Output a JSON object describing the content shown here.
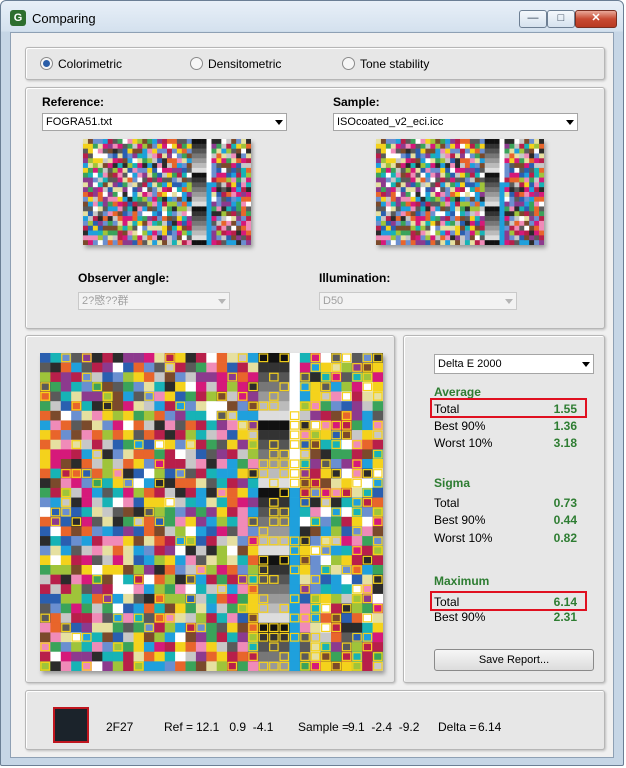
{
  "window": {
    "title": "Comparing",
    "app_icon_glyph": "G"
  },
  "mode": {
    "options": [
      {
        "label": "Colorimetric",
        "selected": true
      },
      {
        "label": "Densitometric",
        "selected": false
      },
      {
        "label": "Tone stability",
        "selected": false
      }
    ]
  },
  "reference": {
    "label": "Reference:",
    "file": "FOGRA51.txt"
  },
  "sample": {
    "label": "Sample:",
    "file": "ISOcoated_v2_eci.icc"
  },
  "observer": {
    "label": "Observer angle:",
    "value": "2?愍??群"
  },
  "illumination": {
    "label": "Illumination:",
    "value": "D50"
  },
  "metric": {
    "value": "Delta E 2000"
  },
  "stats": {
    "average": {
      "heading": "Average",
      "rows": [
        {
          "label": "Total",
          "value": "1.55"
        },
        {
          "label": "Best 90%",
          "value": "1.36"
        },
        {
          "label": "Worst 10%",
          "value": "3.18"
        }
      ]
    },
    "sigma": {
      "heading": "Sigma",
      "rows": [
        {
          "label": "Total",
          "value": "0.73"
        },
        {
          "label": "Best 90%",
          "value": "0.44"
        },
        {
          "label": "Worst 10%",
          "value": "0.82"
        }
      ]
    },
    "maximum": {
      "heading": "Maximum",
      "rows": [
        {
          "label": "Total",
          "value": "6.14"
        },
        {
          "label": "Best 90%",
          "value": "2.31"
        }
      ]
    }
  },
  "save_report_label": "Save Report...",
  "status": {
    "patch_id": "2F27",
    "ref_label": "Ref =",
    "ref_values": "12.1   0.9  -4.1",
    "sample_label": "Sample =",
    "sample_values": "9.1  -2.4  -9.2",
    "delta_label": "Delta =",
    "delta_value": "6.14",
    "swatch_color": "#1b232b"
  },
  "colors": {
    "accent_green": "#2e7d32",
    "highlight_red": "#e01020"
  }
}
